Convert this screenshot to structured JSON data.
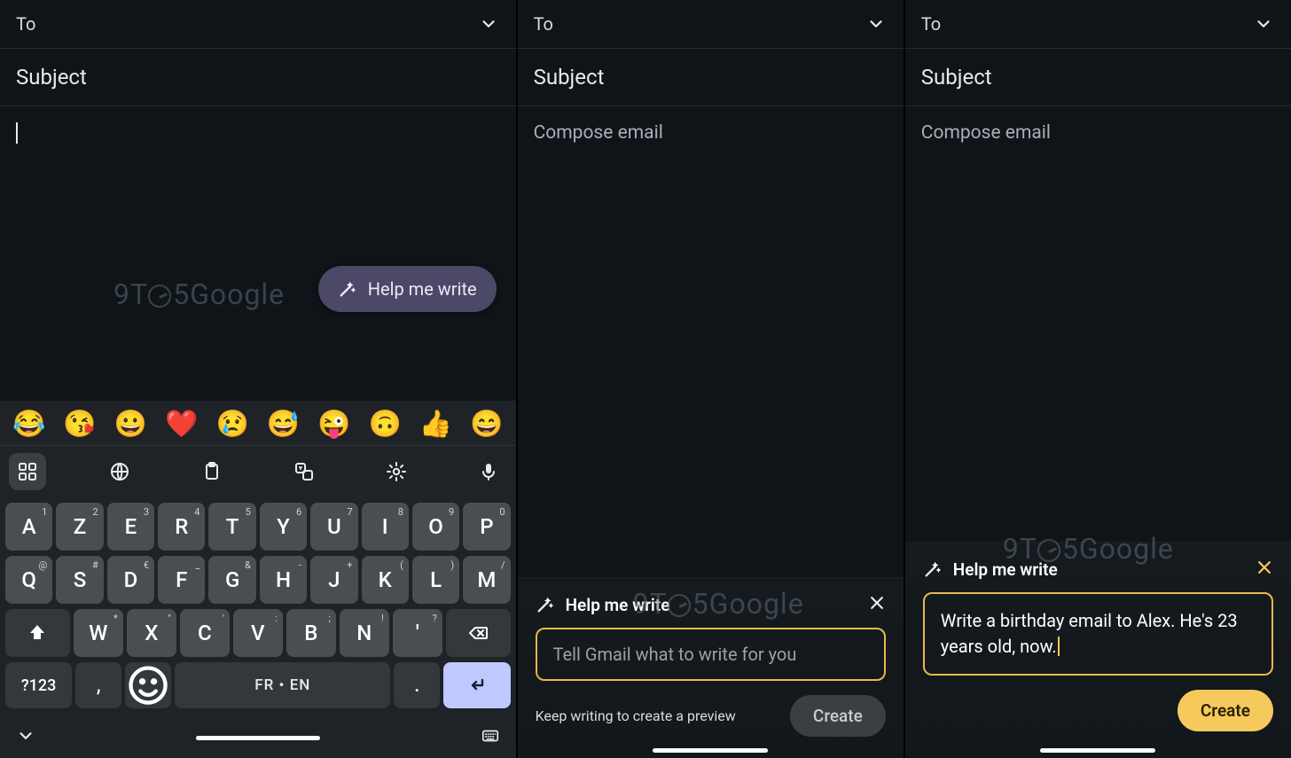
{
  "compose": {
    "to_label": "To",
    "subject_label": "Subject",
    "body_placeholder": "Compose email"
  },
  "help_pill": {
    "label": "Help me write"
  },
  "watermark": {
    "text_a": "9T",
    "text_b": "5Google"
  },
  "keyboard": {
    "emojis": [
      "😂",
      "😘",
      "😀",
      "❤️",
      "😢",
      "😅",
      "😜",
      "🙃",
      "👍",
      "😄"
    ],
    "row1": [
      {
        "k": "A",
        "s": "1"
      },
      {
        "k": "Z",
        "s": "2"
      },
      {
        "k": "E",
        "s": "3"
      },
      {
        "k": "R",
        "s": "4"
      },
      {
        "k": "T",
        "s": "5"
      },
      {
        "k": "Y",
        "s": "6"
      },
      {
        "k": "U",
        "s": "7"
      },
      {
        "k": "I",
        "s": "8"
      },
      {
        "k": "O",
        "s": "9"
      },
      {
        "k": "P",
        "s": "0"
      }
    ],
    "row2": [
      {
        "k": "Q",
        "s": "@"
      },
      {
        "k": "S",
        "s": "#"
      },
      {
        "k": "D",
        "s": "€"
      },
      {
        "k": "F",
        "s": "_"
      },
      {
        "k": "G",
        "s": "&"
      },
      {
        "k": "H",
        "s": "-"
      },
      {
        "k": "J",
        "s": "+"
      },
      {
        "k": "K",
        "s": "("
      },
      {
        "k": "L",
        "s": ")"
      },
      {
        "k": "M",
        "s": "/"
      }
    ],
    "row3": [
      {
        "k": "W",
        "s": "*"
      },
      {
        "k": "X",
        "s": "\""
      },
      {
        "k": "C",
        "s": "'"
      },
      {
        "k": "V",
        "s": ":"
      },
      {
        "k": "B",
        "s": ";"
      },
      {
        "k": "N",
        "s": "!"
      },
      {
        "k": "'",
        "s": "?"
      }
    ],
    "sym_label": "?123",
    "space_label": "FR • EN",
    "comma": ",",
    "period": "."
  },
  "sheet2": {
    "title": "Help me write",
    "placeholder": "Tell Gmail what to write for you",
    "hint": "Keep writing to create a preview",
    "create": "Create"
  },
  "sheet3": {
    "title": "Help me write",
    "text": "Write a birthday email to Alex. He's 23 years old, now.",
    "create": "Create"
  }
}
